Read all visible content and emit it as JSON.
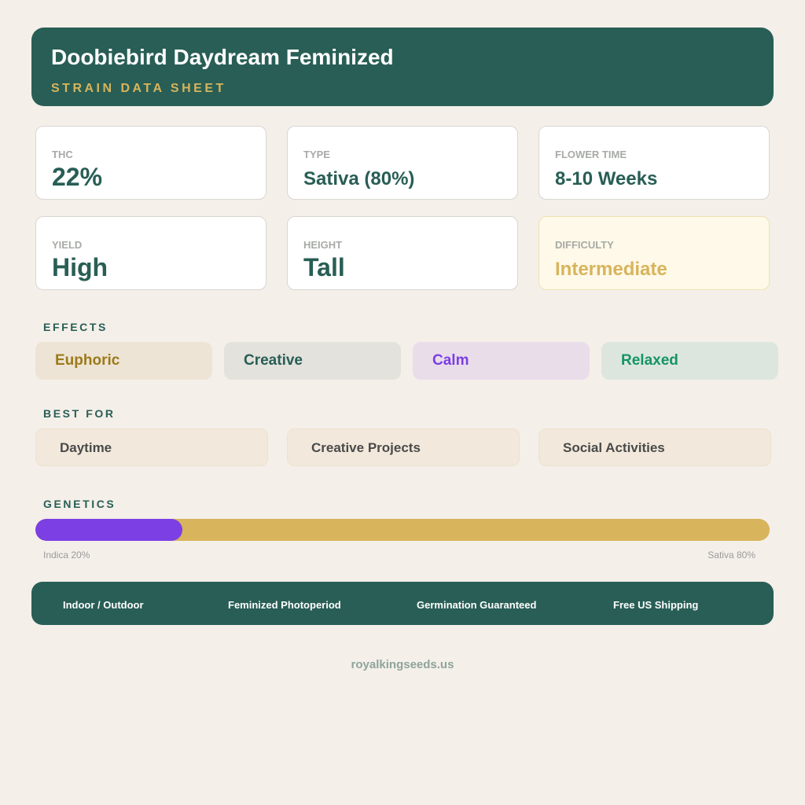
{
  "header": {
    "title": "Doobiebird Daydream Feminized",
    "subtitle": "STRAIN DATA SHEET"
  },
  "stats": [
    {
      "label": "THC",
      "value": "22%"
    },
    {
      "label": "TYPE",
      "value": "Sativa (80%)"
    },
    {
      "label": "FLOWER TIME",
      "value": "8-10 Weeks"
    },
    {
      "label": "YIELD",
      "value": "High"
    },
    {
      "label": "HEIGHT",
      "value": "Tall"
    },
    {
      "label": "DIFFICULTY",
      "value": "Intermediate"
    }
  ],
  "effects": {
    "heading": "EFFECTS",
    "items": [
      {
        "label": "Euphoric",
        "color": "#9a7a1a",
        "bg": "#ede4d5"
      },
      {
        "label": "Creative",
        "color": "#285e55",
        "bg": "#e3e2dc"
      },
      {
        "label": "Calm",
        "color": "#7b3fe4",
        "bg": "#eaddea"
      },
      {
        "label": "Relaxed",
        "color": "#159466",
        "bg": "#dde6de"
      }
    ]
  },
  "best_for": {
    "heading": "BEST FOR",
    "items": [
      "Daytime",
      "Creative Projects",
      "Social Activities"
    ]
  },
  "genetics": {
    "heading": "GENETICS",
    "indica_pct": 20,
    "sativa_pct": 80,
    "indica_label": "Indica 20%",
    "sativa_label": "Sativa 80%",
    "indica_color": "#7b3fe4",
    "sativa_color": "#d8b45c"
  },
  "footer": {
    "items": [
      "Indoor / Outdoor",
      "Feminized Photoperiod",
      "Germination Guaranteed",
      "Free US Shipping"
    ]
  },
  "website": "royalkingseeds.us",
  "colors": {
    "primary": "#285e55",
    "accent": "#d8b45c",
    "background": "#f4efe9"
  }
}
